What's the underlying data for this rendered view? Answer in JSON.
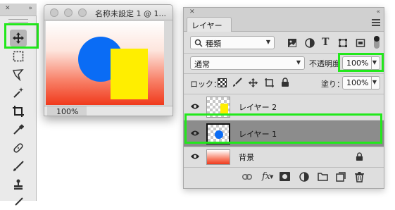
{
  "document": {
    "title": "名称未設定 1 @ 1...",
    "zoom": "100%"
  },
  "layers_panel": {
    "tab_label": "レイヤー",
    "filter": {
      "kind": "種類"
    },
    "blend_mode": "通常",
    "opacity_label": "不透明度",
    "opacity_value": "100%",
    "lock_label": "ロック：",
    "fill_label": "塗り：",
    "fill_value": "100%",
    "layers": [
      {
        "name": "レイヤー 2",
        "visible": true,
        "selected": false
      },
      {
        "name": "レイヤー 1",
        "visible": true,
        "selected": true
      },
      {
        "name": "背景",
        "visible": true,
        "selected": false,
        "locked": true
      }
    ]
  },
  "colors": {
    "circle": "#0a6cf5",
    "rectangle": "#ffee00",
    "highlight": "#22e81c",
    "gradient_bottom": "#f03a1c"
  },
  "tools": [
    "move-tool",
    "rectangular-marquee-tool",
    "lasso-tool",
    "magic-wand-tool",
    "crop-tool",
    "eyedropper-tool",
    "spot-healing-tool",
    "brush-tool",
    "clone-stamp-tool",
    "history-brush-tool"
  ]
}
